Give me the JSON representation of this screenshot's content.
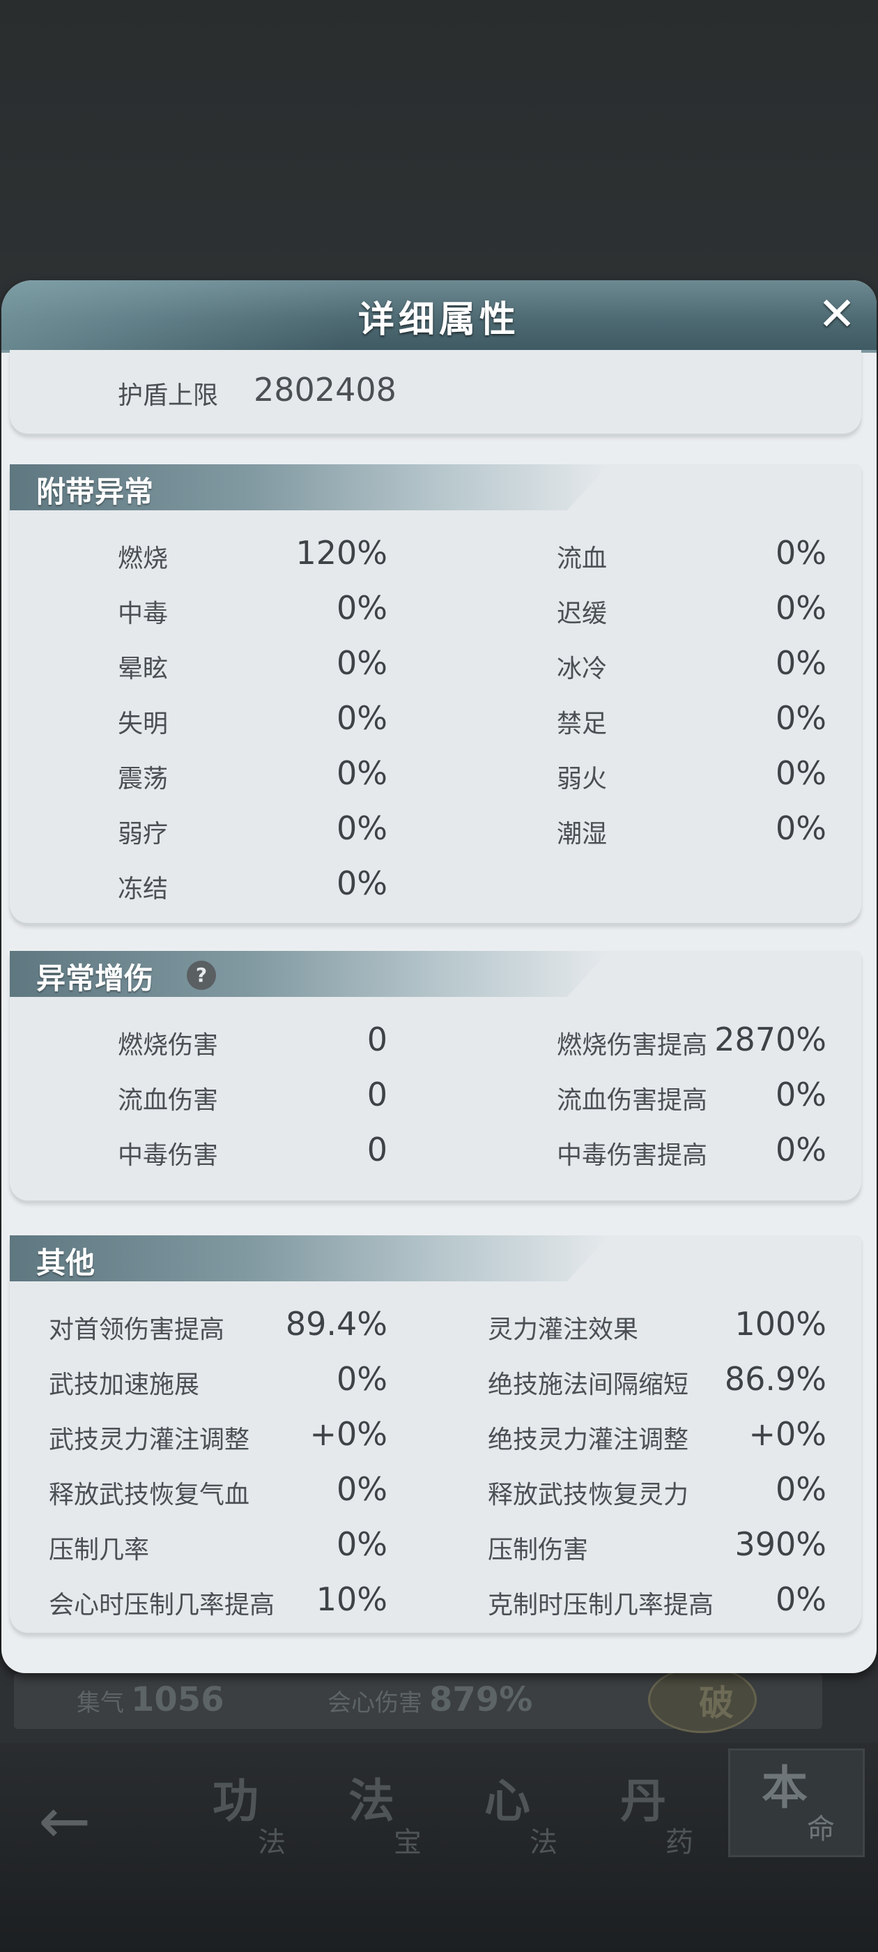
{
  "panel": {
    "title": "详细属性",
    "close_icon": "close-icon",
    "shield": {
      "label": "护盾上限",
      "value": "2802408"
    }
  },
  "sections": {
    "status_effects": {
      "title": "附带异常",
      "left": [
        {
          "label": "燃烧",
          "value": "120%"
        },
        {
          "label": "中毒",
          "value": "0%"
        },
        {
          "label": "晕眩",
          "value": "0%"
        },
        {
          "label": "失明",
          "value": "0%"
        },
        {
          "label": "震荡",
          "value": "0%"
        },
        {
          "label": "弱疗",
          "value": "0%"
        },
        {
          "label": "冻结",
          "value": "0%"
        }
      ],
      "right": [
        {
          "label": "流血",
          "value": "0%"
        },
        {
          "label": "迟缓",
          "value": "0%"
        },
        {
          "label": "冰冷",
          "value": "0%"
        },
        {
          "label": "禁足",
          "value": "0%"
        },
        {
          "label": "弱火",
          "value": "0%"
        },
        {
          "label": "潮湿",
          "value": "0%"
        }
      ]
    },
    "status_damage": {
      "title": "异常增伤",
      "help_icon": "?",
      "left": [
        {
          "label": "燃烧伤害",
          "value": "0"
        },
        {
          "label": "流血伤害",
          "value": "0"
        },
        {
          "label": "中毒伤害",
          "value": "0"
        }
      ],
      "right": [
        {
          "label": "燃烧伤害提高",
          "value": "2870%"
        },
        {
          "label": "流血伤害提高",
          "value": "0%"
        },
        {
          "label": "中毒伤害提高",
          "value": "0%"
        }
      ]
    },
    "other": {
      "title": "其他",
      "left": [
        {
          "label": "对首领伤害提高",
          "value": "89.4%"
        },
        {
          "label": "武技加速施展",
          "value": "0%"
        },
        {
          "label": "武技灵力灌注调整",
          "value": "+0%"
        },
        {
          "label": "释放武技恢复气血",
          "value": "0%"
        },
        {
          "label": "压制几率",
          "value": "0%"
        },
        {
          "label": "会心时压制几率提高",
          "value": "10%"
        }
      ],
      "right": [
        {
          "label": "灵力灌注效果",
          "value": "100%"
        },
        {
          "label": "绝技施法间隔缩短",
          "value": "86.9%"
        },
        {
          "label": "绝技灵力灌注调整",
          "value": "+0%"
        },
        {
          "label": "释放武技恢复灵力",
          "value": "0%"
        },
        {
          "label": "压制伤害",
          "value": "390%"
        },
        {
          "label": "克制时压制几率提高",
          "value": "0%"
        }
      ]
    }
  },
  "background": {
    "stat1": {
      "label": "集气",
      "value": "1056"
    },
    "stat2": {
      "label": "会心伤害",
      "value": "879%"
    },
    "coin_text": "破",
    "nav": {
      "back_icon": "←",
      "tabs": [
        {
          "big": "功",
          "small": "法"
        },
        {
          "big": "法",
          "small": "宝"
        },
        {
          "big": "心",
          "small": "法"
        },
        {
          "big": "丹",
          "small": "药"
        },
        {
          "big": "本",
          "small": "命"
        }
      ]
    }
  }
}
